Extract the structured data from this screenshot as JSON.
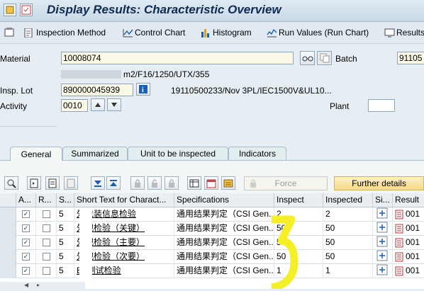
{
  "window": {
    "title": "Display Results: Characteristic Overview"
  },
  "toolbar": {
    "inspection_method": "Inspection Method",
    "control_chart": "Control Chart",
    "histogram": "Histogram",
    "run_values": "Run Values (Run Chart)",
    "results": "Results"
  },
  "header": {
    "material_label": "Material",
    "material_value": "10008074",
    "material_desc": "m2/F16/1250/UTX/355",
    "batch_label": "Batch",
    "batch_value": "91105",
    "insp_lot_label": "Insp. Lot",
    "insp_lot_value": "890000045939",
    "insp_lot_desc": "19110500233/Nov 3PL/IEC1500V&UL10...",
    "activity_label": "Activity",
    "activity_value": "0010",
    "plant_label": "Plant"
  },
  "tabs": [
    "General",
    "Summarized",
    "Unit to be inspected",
    "Indicators"
  ],
  "grid_toolbar": {
    "force": "Force",
    "further_details": "Further details"
  },
  "table": {
    "columns": [
      "A...",
      "R...",
      "S...",
      "Short Text for Charact...",
      "Specifications",
      "Inspect",
      "Inspected",
      "Si...",
      "Result"
    ],
    "rows": [
      {
        "s": "5",
        "short_text": "外包装信息检验",
        "spec": "通用结果判定（CSI Gen...",
        "inspect": "2",
        "inspected": "2",
        "result": "001"
      },
      {
        "s": "5",
        "short_text": "外观检验（关键）",
        "spec": "通用结果判定（CSI Gen...",
        "inspect": "50",
        "inspected": "50",
        "result": "001"
      },
      {
        "s": "5",
        "short_text": "外观检验（主要）",
        "spec": "通用结果判定（CSI Gen...",
        "inspect": "50",
        "inspected": "50",
        "result": "001"
      },
      {
        "s": "5",
        "short_text": "外观检验（次要）",
        "spec": "通用结果判定（CSI Gen...",
        "inspect": "50",
        "inspected": "50",
        "result": "001"
      },
      {
        "s": "5",
        "short_text": "EL测试检验",
        "spec": "通用结果判定（CSI Gen...",
        "inspect": "1",
        "inspected": "1",
        "result": "001"
      }
    ]
  },
  "colors": {
    "highlight_yellow": "#f5ef2a",
    "header_bg": "#c9d9e6",
    "field_bg": "#fbf9e6"
  }
}
